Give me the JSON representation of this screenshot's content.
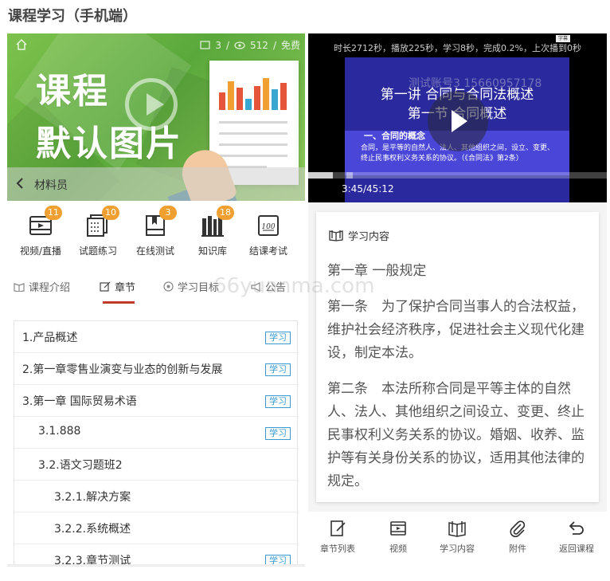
{
  "page": {
    "title": "课程学习（手机端）",
    "watermark": "66yuanma.com"
  },
  "left": {
    "banner": {
      "line1": "课程",
      "line2": "默认图片",
      "lessons": "3",
      "views": "512",
      "price": "免费",
      "teacher": "材料员"
    },
    "features": [
      {
        "label": "视频/直播",
        "badge": "11",
        "icon": "video-icon"
      },
      {
        "label": "试题练习",
        "badge": "10",
        "icon": "exercise-icon"
      },
      {
        "label": "在线测试",
        "badge": "3",
        "icon": "test-icon"
      },
      {
        "label": "知识库",
        "badge": "18",
        "icon": "library-icon"
      },
      {
        "label": "结课考试",
        "badge": "",
        "icon": "exam-icon"
      }
    ],
    "tabs": [
      {
        "label": "课程介绍"
      },
      {
        "label": "章节"
      },
      {
        "label": "学习目标"
      },
      {
        "label": "公告"
      }
    ],
    "active_tab": "章节",
    "learn_tag": "学习",
    "chapters": [
      {
        "text": "1.产品概述",
        "level": 0,
        "tag": true
      },
      {
        "text": "2.第一章零售业演变与业态的创新与发展",
        "level": 0,
        "tag": true
      },
      {
        "text": "3.第一章 国际贸易术语",
        "level": 0,
        "tag": true
      },
      {
        "text": "3.1.888",
        "level": 1,
        "tag": true
      },
      {
        "text": "3.2.语文习题班2",
        "level": 1,
        "tag": false
      },
      {
        "text": "3.2.1.解决方案",
        "level": 2,
        "tag": false
      },
      {
        "text": "3.2.2.系统概述",
        "level": 2,
        "tag": false
      },
      {
        "text": "3.2.3.章节测试",
        "level": 2,
        "tag": true
      }
    ]
  },
  "right": {
    "video": {
      "info": "时长2712秒，播放225秒，学习8秒，完成0.2%，上次播到0秒",
      "watermark": "测试账号3 15660957178",
      "slide_title1": "第一讲 合同与合同法概述",
      "slide_title2": "第一节 合同概述",
      "slide_sub": "一、合同的概念",
      "slide_body": "合同，是平等的自然人、法人、其他组织之间，设立、变更、终止民事权利义务关系的协议。（《合同法》第2条）",
      "time": "3:45/45:12",
      "progress": 0.083,
      "mini_badge": "字幕"
    },
    "content": {
      "heading": "学习内容",
      "paragraphs": [
        "第一章 一般规定",
        "第一条　为了保护合同当事人的合法权益，维护社会经济秩序，促进社会主义现代化建设，制定本法。",
        "第二条　本法所称合同是平等主体的自然人、法人、其他组织之间设立、变更、终止民事权利义务关系的协议。婚姻、收养、监护等有关身份关系的协议，适用其他法律的规定。"
      ]
    },
    "nav": [
      {
        "label": "章节列表",
        "icon": "chapter-list-icon"
      },
      {
        "label": "视频",
        "icon": "video-icon"
      },
      {
        "label": "学习内容",
        "icon": "book-icon"
      },
      {
        "label": "附件",
        "icon": "paperclip-icon"
      },
      {
        "label": "返回课程",
        "icon": "return-icon"
      }
    ]
  },
  "colors": {
    "accent": "#c0392b",
    "tag": "#3a9bd0",
    "badge": "#f0a030",
    "banner": "#6ab845"
  }
}
